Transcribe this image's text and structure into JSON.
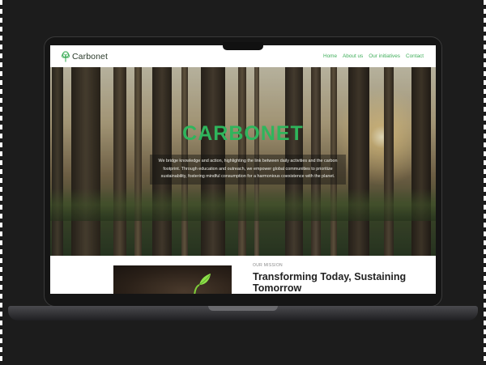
{
  "site": {
    "logo_text": "Carbonet",
    "nav": [
      "Home",
      "About us",
      "Our initiatives",
      "Contact"
    ]
  },
  "hero": {
    "title": "CARBONET",
    "text": "We bridge knowledge and action, highlighting the link between daily activities and the carbon footprint. Through education and outreach, we empower global communities to prioritize sustainability, fostering mindful consumption for a harmonious coexistence with the planet."
  },
  "mission": {
    "label": "OUR MISSION",
    "title": "Transforming Today, Sustaining Tomorrow"
  },
  "colors": {
    "accent_green": "#3fae5a",
    "hero_title": "#2fb55c",
    "background": "#1c1c1c"
  },
  "icons": {
    "logo": "tree-icon"
  }
}
